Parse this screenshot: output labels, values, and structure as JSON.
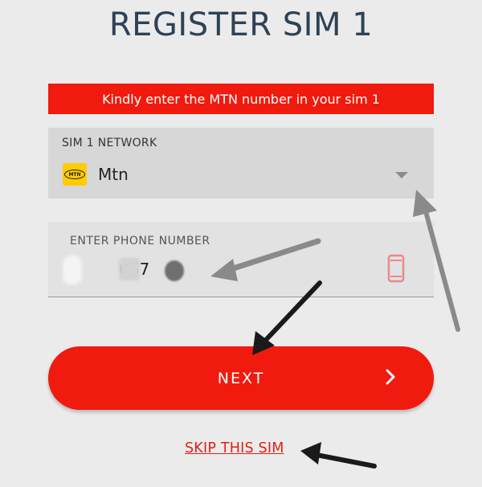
{
  "page_title": "REGISTER SIM 1",
  "banner_text": "Kindly enter the MTN number in your sim 1",
  "network": {
    "label": "SIM 1 NETWORK",
    "value": "Mtn",
    "logo_text": "MTN",
    "logo_color": "#ffcc00"
  },
  "phone": {
    "label": "ENTER PHONE NUMBER",
    "value": "067",
    "icon": "smartphone-icon",
    "icon_color": "#e88a8a"
  },
  "next_button": {
    "label": "NEXT",
    "icon": "chevron-right-icon"
  },
  "skip_link": "SKIP THIS SIM",
  "colors": {
    "accent": "#f01a0e",
    "title": "#2d4256",
    "background": "#ebebeb",
    "annotation_gray": "#8a8a8a",
    "annotation_black": "#1a1a1a"
  }
}
